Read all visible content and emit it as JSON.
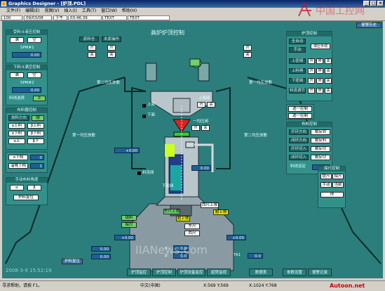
{
  "window": {
    "title": "Graphics Designer - [炉顶.PDL]",
    "min": "_",
    "max": "□",
    "close": "×"
  },
  "menu": [
    "文件(F)",
    "编辑(E)",
    "视图(V)",
    "插入(I)",
    "工具(T)",
    "窗口(W)",
    "帮助(H)"
  ],
  "toolbar": {
    "field1": "100",
    "date": "09/03/08",
    "shift": "下午",
    "time": "03:46:39",
    "text1": "TEXT",
    "text2": "TEXT"
  },
  "watermarks": {
    "top_logo": "中国工控网",
    "center": "IIANews.com",
    "bottom_right": "Autoon.net"
  },
  "hmi": {
    "title": "高炉炉顶控制",
    "alarm_button": "报警历史",
    "left": {
      "p1": {
        "title": "受料斗液压控制",
        "b1": "满",
        "b2": "空",
        "val_label": "SPM#1",
        "v1": "0.00"
      },
      "p2": {
        "title": "下料斗满空控制",
        "b1": "满",
        "b2": "空",
        "val_label": "SPM#2",
        "v1": "0.00",
        "sel": "料线选择",
        "sel_btn": "0"
      },
      "p3": {
        "title": "布料器控制",
        "b1": "放料方向",
        "b2": "顺",
        "b3": "α上料",
        "b4": "β上料",
        "b5": "α下料",
        "b6": "β下料",
        "b7": "α上",
        "b8": "β下"
      },
      "p4": {
        "a_label": "α下档",
        "a_val": "0",
        "b_label": "溜嘴下档",
        "b_val": "1"
      },
      "p5": {
        "title": "手动布料角度",
        "b1": "α",
        "b2": "β",
        "c1": "炉料复位"
      }
    },
    "right": {
      "p1": {
        "title": "炉顶控制",
        "rows": [
          "全自动",
          "手动",
          "上密阀",
          "上料闸",
          "下密阀",
          "料流调节"
        ],
        "b1": "开",
        "b2": "停",
        "b3": "关",
        "side": "液压手动"
      },
      "p2": {
        "b1": "选一控制",
        "b2": "选一控制"
      },
      "p3": {
        "title": "布料控制",
        "rows": [
          "开环方向",
          "闭环方向",
          "开环切入",
          "闭环切入"
        ],
        "cols": [
          "顺反转",
          "顺反料",
          "顺反切",
          "顺反切"
        ],
        "lbl": "料线设定",
        "val": "0.00"
      },
      "p4": {
        "title": "探尺控制",
        "b1": "提尺",
        "b2": "探尺",
        "b3": "手动",
        "b4": "当前",
        "b5": "停"
      }
    },
    "center": {
      "equalizer_1": "第一均压放散",
      "equalizer_2": "第二均压放散",
      "equalizer_3": "第一均压放散",
      "equalizer_4": "第二均压放散",
      "valve_labels": [
        "原料仓",
        "本原操作",
        "上面",
        "下面",
        "上面阀",
        "一均压阀",
        "料流阀",
        "下密阀",
        "料流调节阀"
      ],
      "values": [
        "0.00",
        "0.00",
        "+0.00",
        "0.00",
        "+0.00",
        "0.00",
        "0.00",
        "0.00",
        "+0.00"
      ],
      "status": [
        "西尺上限",
        "超上限",
        "东尺上限",
        "超上限",
        "拢料",
        "探尺",
        "东尺",
        "西尺",
        "下密阀",
        "料流调节"
      ],
      "tags": [
        "α:",
        "β:",
        "料线",
        "TA1"
      ],
      "readouts": [
        "0",
        "0.0",
        "0.0",
        "0.0"
      ]
    },
    "bottom_bar": {
      "date": "2008-3-9 15:52:19",
      "btn1": "炉顶监控",
      "btn2": "炉顶控制",
      "btn3": "炉顶设备监控",
      "btn4": "趋势监视",
      "btn5": "数据表",
      "btn6": "报警历史",
      "btn7": "参数设置",
      "btn8": "报警记录",
      "btn9": "主画面"
    }
  },
  "status": {
    "help": "寻求帮助，请按 F1。",
    "lang": "中文(中国)",
    "pos": "X:569 Y:569",
    "size": "X:1024 Y:768"
  }
}
